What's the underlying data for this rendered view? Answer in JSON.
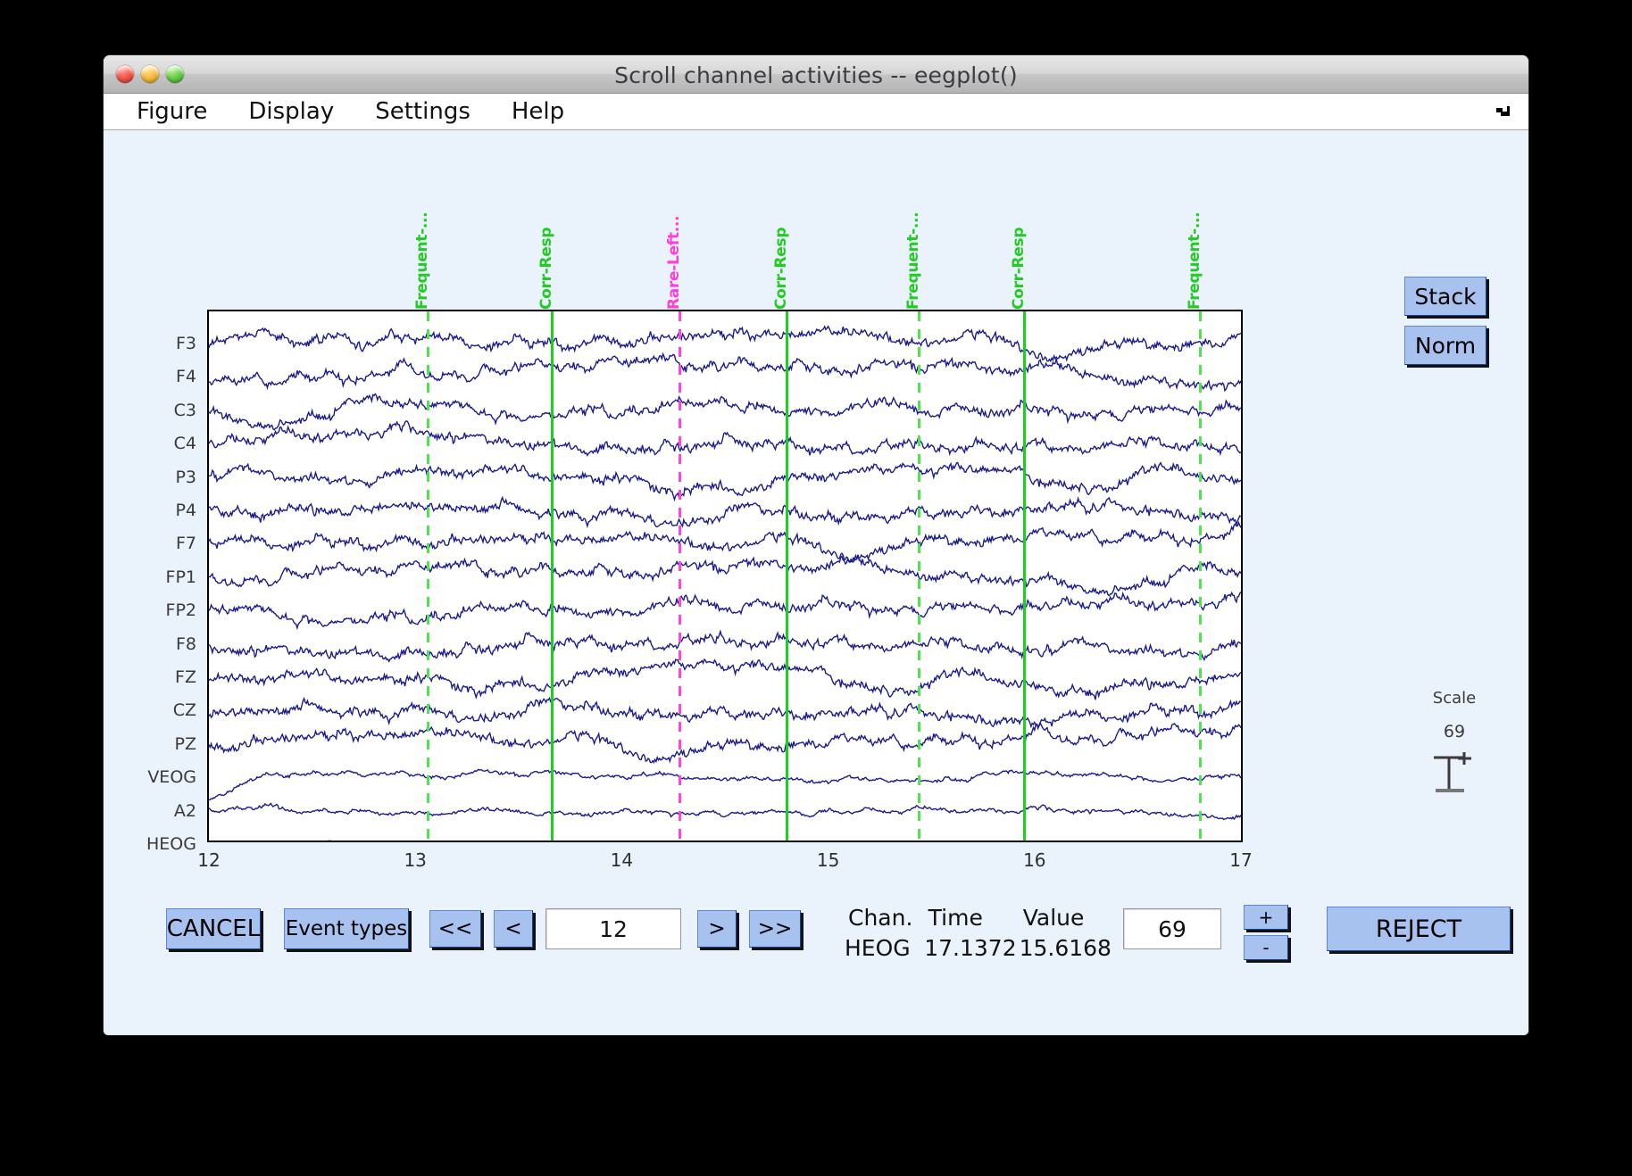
{
  "window": {
    "title": "Scroll channel activities -- eegplot()",
    "traffic_lights": [
      "close",
      "minimize",
      "zoom"
    ]
  },
  "menubar": {
    "items": [
      {
        "label": "Figure"
      },
      {
        "label": "Display"
      },
      {
        "label": "Settings"
      },
      {
        "label": "Help"
      }
    ],
    "resize_icon": "resize-arrow-icon"
  },
  "right_buttons": {
    "stack_label": "Stack",
    "norm_label": "Norm"
  },
  "scale_widget": {
    "title": "Scale",
    "value": "69"
  },
  "plot": {
    "channels": [
      "F3",
      "F4",
      "C3",
      "C4",
      "P3",
      "P4",
      "F7",
      "FP1",
      "FP2",
      "F8",
      "FZ",
      "CZ",
      "PZ",
      "VEOG",
      "A2",
      "HEOG"
    ],
    "xticks": [
      "12",
      "13",
      "14",
      "15",
      "16",
      "17"
    ],
    "events": [
      {
        "label": "Frequent-...",
        "time": 13.06,
        "color": "#22cc22",
        "style": "dashed"
      },
      {
        "label": "Corr-Resp",
        "time": 13.66,
        "color": "#19d219",
        "style": "solid"
      },
      {
        "label": "Rare-Left...",
        "time": 14.28,
        "color": "#ff3ddd",
        "style": "dashed"
      },
      {
        "label": "Corr-Resp",
        "time": 14.8,
        "color": "#19d219",
        "style": "solid"
      },
      {
        "label": "Frequent-...",
        "time": 15.44,
        "color": "#22cc22",
        "style": "dashed"
      },
      {
        "label": "Corr-Resp",
        "time": 15.95,
        "color": "#19d219",
        "style": "solid"
      },
      {
        "label": "Frequent-...",
        "time": 16.8,
        "color": "#22cc22",
        "style": "dashed"
      }
    ],
    "trace_color": "#1c1c8f",
    "background": "#ffffff"
  },
  "controls": {
    "cancel_label": "CANCEL",
    "event_types_label": "Event types",
    "first_label": "<<",
    "prev_label": "<",
    "next_label": ">",
    "last_label": ">>",
    "position_value": "12",
    "scale_value": "69",
    "plus_label": "+",
    "minus_label": "-",
    "reject_label": "REJECT"
  },
  "readout": {
    "head_chan": "Chan.",
    "head_time": "Time",
    "head_value": "Value",
    "chan": "HEOG",
    "time": "17.1372",
    "value": "15.6168"
  },
  "chart_data": {
    "type": "line",
    "title": "Scroll channel activities -- eegplot()",
    "xlabel": "",
    "ylabel": "",
    "xlim": [
      12,
      17
    ],
    "xticks": [
      12,
      13,
      14,
      15,
      16,
      17
    ],
    "grid": false,
    "legend": "none",
    "series": [
      {
        "name": "F3",
        "row": 0
      },
      {
        "name": "F4",
        "row": 1
      },
      {
        "name": "C3",
        "row": 2
      },
      {
        "name": "C4",
        "row": 3
      },
      {
        "name": "P3",
        "row": 4
      },
      {
        "name": "P4",
        "row": 5
      },
      {
        "name": "F7",
        "row": 6
      },
      {
        "name": "FP1",
        "row": 7
      },
      {
        "name": "FP2",
        "row": 8
      },
      {
        "name": "F8",
        "row": 9
      },
      {
        "name": "FZ",
        "row": 10
      },
      {
        "name": "CZ",
        "row": 11
      },
      {
        "name": "PZ",
        "row": 12
      },
      {
        "name": "VEOG",
        "row": 13
      },
      {
        "name": "A2",
        "row": 14
      },
      {
        "name": "HEOG",
        "row": 15
      }
    ],
    "annotations": [
      {
        "text": "Frequent-...",
        "x": 13.06,
        "color": "#22cc22"
      },
      {
        "text": "Corr-Resp",
        "x": 13.66,
        "color": "#19d219"
      },
      {
        "text": "Rare-Left...",
        "x": 14.28,
        "color": "#ff3ddd"
      },
      {
        "text": "Corr-Resp",
        "x": 14.8,
        "color": "#19d219"
      },
      {
        "text": "Frequent-...",
        "x": 15.44,
        "color": "#22cc22"
      },
      {
        "text": "Corr-Resp",
        "x": 15.95,
        "color": "#19d219"
      },
      {
        "text": "Frequent-...",
        "x": 16.8,
        "color": "#22cc22"
      }
    ]
  }
}
